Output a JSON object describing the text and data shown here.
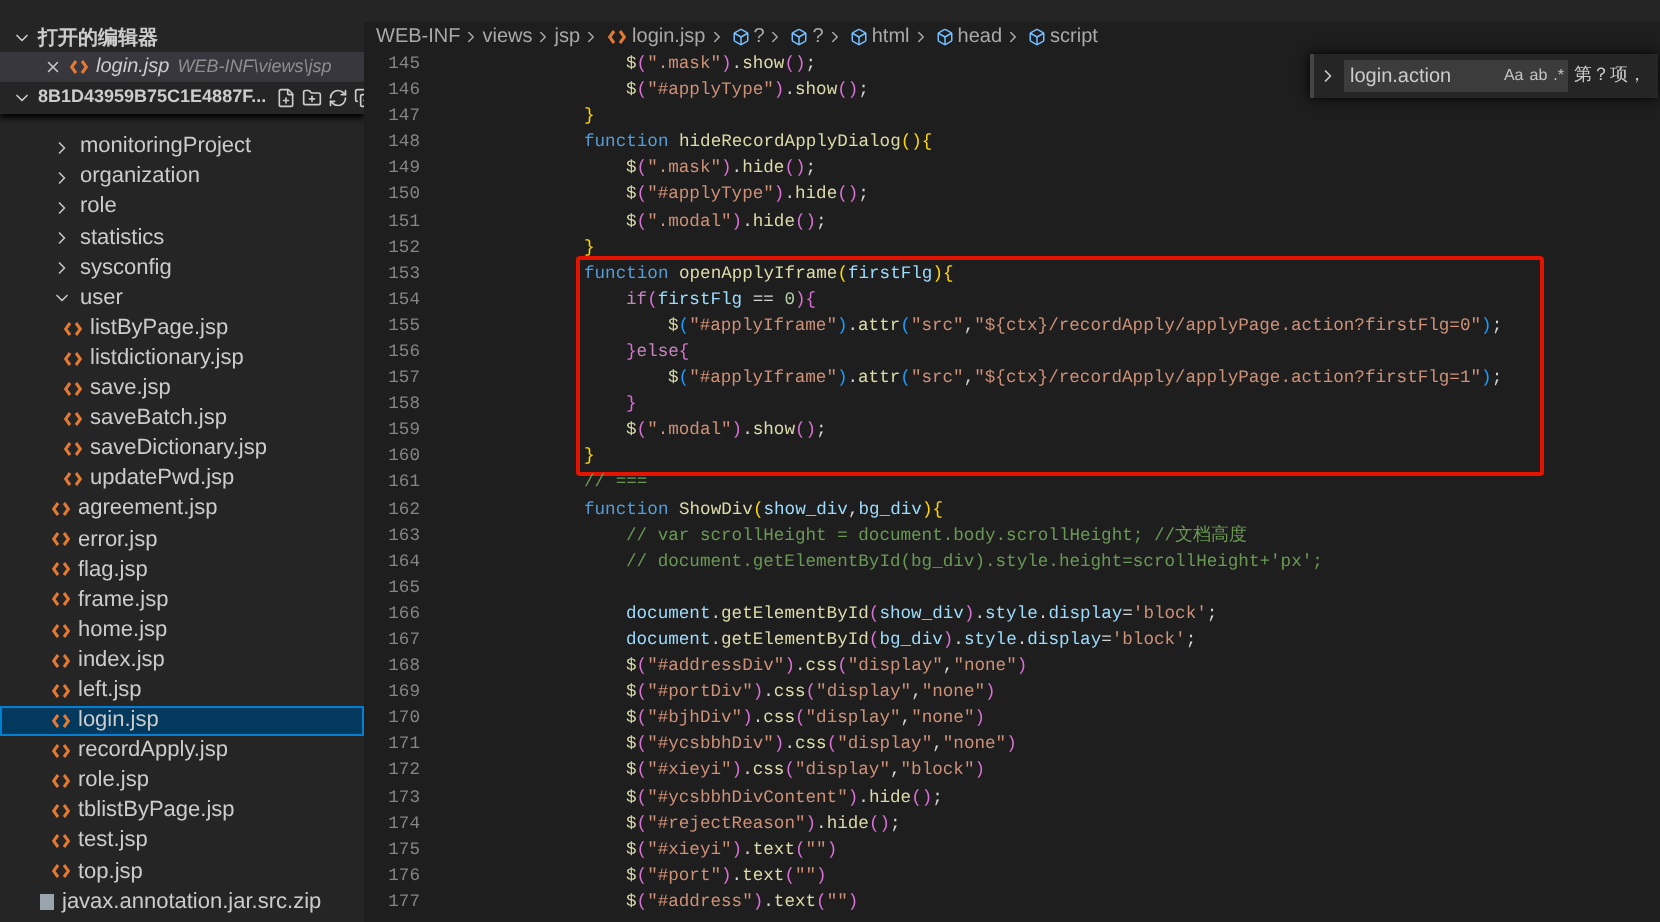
{
  "sidebar": {
    "section_title": "打开的编辑器",
    "section_expanded": true,
    "open_editors": [
      {
        "name": "login.jsp",
        "path": "WEB-INF\\views\\jsp"
      }
    ],
    "folder": {
      "name": "8B1D43959B75C1E4887F...",
      "expanded": true
    },
    "tree": [
      {
        "name": "monitoringProject",
        "kind": "folder",
        "expanded": false,
        "selected": false
      },
      {
        "name": "organization",
        "kind": "folder",
        "expanded": false,
        "selected": false
      },
      {
        "name": "role",
        "kind": "folder",
        "expanded": false,
        "selected": false
      },
      {
        "name": "statistics",
        "kind": "folder",
        "expanded": false,
        "selected": false
      },
      {
        "name": "sysconfig",
        "kind": "folder",
        "expanded": false,
        "selected": false
      },
      {
        "name": "user",
        "kind": "folder",
        "expanded": true,
        "selected": false,
        "children": [
          {
            "name": "listByPage.jsp",
            "kind": "file",
            "selected": false
          },
          {
            "name": "listdictionary.jsp",
            "kind": "file",
            "selected": false
          },
          {
            "name": "save.jsp",
            "kind": "file",
            "selected": false
          },
          {
            "name": "saveBatch.jsp",
            "kind": "file",
            "selected": false
          },
          {
            "name": "saveDictionary.jsp",
            "kind": "file",
            "selected": false
          },
          {
            "name": "updatePwd.jsp",
            "kind": "file",
            "selected": false
          }
        ]
      },
      {
        "name": "agreement.jsp",
        "kind": "file",
        "selected": false
      },
      {
        "name": "error.jsp",
        "kind": "file",
        "selected": false
      },
      {
        "name": "flag.jsp",
        "kind": "file",
        "selected": false
      },
      {
        "name": "frame.jsp",
        "kind": "file",
        "selected": false
      },
      {
        "name": "home.jsp",
        "kind": "file",
        "selected": false
      },
      {
        "name": "index.jsp",
        "kind": "file",
        "selected": false
      },
      {
        "name": "left.jsp",
        "kind": "file",
        "selected": false
      },
      {
        "name": "login.jsp",
        "kind": "file",
        "selected": true
      },
      {
        "name": "recordApply.jsp",
        "kind": "file",
        "selected": false
      },
      {
        "name": "role.jsp",
        "kind": "file",
        "selected": false
      },
      {
        "name": "tblistByPage.jsp",
        "kind": "file",
        "selected": false
      },
      {
        "name": "test.jsp",
        "kind": "file",
        "selected": false
      },
      {
        "name": "top.jsp",
        "kind": "file",
        "selected": false
      },
      {
        "name": "javax.annotation.jar.src.zip",
        "kind": "archive",
        "selected": false
      }
    ]
  },
  "breadcrumbs": [
    {
      "label": "WEB-INF",
      "kind": "folder"
    },
    {
      "label": "views",
      "kind": "folder"
    },
    {
      "label": "jsp",
      "kind": "folder"
    },
    {
      "label": "login.jsp",
      "kind": "file"
    },
    {
      "label": "?",
      "kind": "symbol"
    },
    {
      "label": "?",
      "kind": "symbol"
    },
    {
      "label": "html",
      "kind": "symbol"
    },
    {
      "label": "head",
      "kind": "symbol"
    },
    {
      "label": "script",
      "kind": "symbol"
    }
  ],
  "find_widget": {
    "expanded": false,
    "value": "login.action",
    "options": [
      "Aa",
      "ab",
      ".*"
    ],
    "result": "第？项，"
  },
  "code_blocks": [
    {
      "lines": [
        {
          "number": "145",
          "kind": "level3",
          "tokens": [
            {
              "kind": "fn",
              "text": "$"
            },
            {
              "kind": "b2",
              "text": "("
            },
            {
              "kind": "str",
              "text": "\".mask\""
            },
            {
              "kind": "b2",
              "text": ")"
            },
            {
              "kind": "p",
              "text": "."
            },
            {
              "kind": "fn",
              "text": "show"
            },
            {
              "kind": "b2",
              "text": "()"
            },
            {
              "kind": "p",
              "text": ";"
            }
          ]
        },
        {
          "number": "146",
          "kind": "level3",
          "tokens": [
            {
              "kind": "fn",
              "text": "$"
            },
            {
              "kind": "b2",
              "text": "("
            },
            {
              "kind": "str",
              "text": "\"#applyType\""
            },
            {
              "kind": "b2",
              "text": ")"
            },
            {
              "kind": "p",
              "text": "."
            },
            {
              "kind": "fn",
              "text": "show"
            },
            {
              "kind": "b2",
              "text": "()"
            },
            {
              "kind": "p",
              "text": ";"
            }
          ]
        },
        {
          "number": "147",
          "kind": "level2",
          "tokens": [
            {
              "kind": "b1",
              "text": "}"
            }
          ]
        },
        {
          "number": "148",
          "kind": "level2",
          "tokens": [
            {
              "kind": "kw",
              "text": "function"
            },
            {
              "kind": "fn",
              "text": "hideRecordApplyDialog"
            },
            {
              "kind": "b1",
              "text": "(){"
            }
          ]
        },
        {
          "number": "149",
          "kind": "level3",
          "tokens": [
            {
              "kind": "fn",
              "text": "$"
            },
            {
              "kind": "b2",
              "text": "("
            },
            {
              "kind": "str",
              "text": "\".mask\""
            },
            {
              "kind": "b2",
              "text": ")"
            },
            {
              "kind": "p",
              "text": "."
            },
            {
              "kind": "fn",
              "text": "hide"
            },
            {
              "kind": "b2",
              "text": "()"
            },
            {
              "kind": "p",
              "text": ";"
            }
          ]
        },
        {
          "number": "150",
          "kind": "level3",
          "tokens": [
            {
              "kind": "fn",
              "text": "$"
            },
            {
              "kind": "b2",
              "text": "("
            },
            {
              "kind": "str",
              "text": "\"#applyType\""
            },
            {
              "kind": "b2",
              "text": ")"
            },
            {
              "kind": "p",
              "text": "."
            },
            {
              "kind": "fn",
              "text": "hide"
            },
            {
              "kind": "b2",
              "text": "()"
            },
            {
              "kind": "p",
              "text": ";"
            }
          ]
        },
        {
          "number": "151",
          "kind": "level3",
          "tokens": [
            {
              "kind": "fn",
              "text": "$"
            },
            {
              "kind": "b2",
              "text": "("
            },
            {
              "kind": "str",
              "text": "\".modal\""
            },
            {
              "kind": "b2",
              "text": ")"
            },
            {
              "kind": "p",
              "text": "."
            },
            {
              "kind": "fn",
              "text": "hide"
            },
            {
              "kind": "b2",
              "text": "()"
            },
            {
              "kind": "p",
              "text": ";"
            }
          ]
        },
        {
          "number": "152",
          "kind": "level2",
          "tokens": [
            {
              "kind": "b1",
              "text": "}"
            }
          ]
        }
      ]
    },
    {
      "boxed": true,
      "lines": [
        {
          "number": "153",
          "kind": "level2",
          "tokens": [
            {
              "kind": "kw",
              "text": "function"
            },
            {
              "kind": "fn",
              "text": "openApplyIframe"
            },
            {
              "kind": "b1",
              "text": "("
            },
            {
              "kind": "var",
              "text": "firstFlg"
            },
            {
              "kind": "b1",
              "text": "){"
            }
          ]
        },
        {
          "number": "154",
          "kind": "level3",
          "tokens": [
            {
              "kind": "ctl",
              "text": "if"
            },
            {
              "kind": "b2",
              "text": "("
            },
            {
              "kind": "var",
              "text": "firstFlg"
            },
            {
              "kind": "p",
              "text": " == "
            },
            {
              "kind": "num",
              "text": "0"
            },
            {
              "kind": "b2",
              "text": "){"
            }
          ]
        },
        {
          "number": "155",
          "kind": "level4",
          "tokens": [
            {
              "kind": "fn",
              "text": "$"
            },
            {
              "kind": "b3",
              "text": "("
            },
            {
              "kind": "str",
              "text": "\"#applyIframe\""
            },
            {
              "kind": "b3",
              "text": ")"
            },
            {
              "kind": "p",
              "text": "."
            },
            {
              "kind": "fn",
              "text": "attr"
            },
            {
              "kind": "b3",
              "text": "("
            },
            {
              "kind": "str",
              "text": "\"src\""
            },
            {
              "kind": "p",
              "text": ","
            },
            {
              "kind": "str",
              "text": "\"${ctx}/recordApply/applyPage.action?firstFlg=0\""
            },
            {
              "kind": "b3",
              "text": ")"
            },
            {
              "kind": "p",
              "text": ";"
            }
          ]
        },
        {
          "number": "156",
          "kind": "level3",
          "tokens": [
            {
              "kind": "b2",
              "text": "}"
            },
            {
              "kind": "ctl",
              "text": "else"
            },
            {
              "kind": "b2",
              "text": "{"
            }
          ]
        },
        {
          "number": "157",
          "kind": "level4",
          "tokens": [
            {
              "kind": "fn",
              "text": "$"
            },
            {
              "kind": "b3",
              "text": "("
            },
            {
              "kind": "str",
              "text": "\"#applyIframe\""
            },
            {
              "kind": "b3",
              "text": ")"
            },
            {
              "kind": "p",
              "text": "."
            },
            {
              "kind": "fn",
              "text": "attr"
            },
            {
              "kind": "b3",
              "text": "("
            },
            {
              "kind": "str",
              "text": "\"src\""
            },
            {
              "kind": "p",
              "text": ","
            },
            {
              "kind": "str",
              "text": "\"${ctx}/recordApply/applyPage.action?firstFlg=1\""
            },
            {
              "kind": "b3",
              "text": ")"
            },
            {
              "kind": "p",
              "text": ";"
            }
          ]
        },
        {
          "number": "158",
          "kind": "level3",
          "tokens": [
            {
              "kind": "b2",
              "text": "}"
            }
          ]
        },
        {
          "number": "159",
          "kind": "level3",
          "tokens": [
            {
              "kind": "fn",
              "text": "$"
            },
            {
              "kind": "b2",
              "text": "("
            },
            {
              "kind": "str",
              "text": "\".modal\""
            },
            {
              "kind": "b2",
              "text": ")"
            },
            {
              "kind": "p",
              "text": "."
            },
            {
              "kind": "fn",
              "text": "show"
            },
            {
              "kind": "b2",
              "text": "()"
            },
            {
              "kind": "p",
              "text": ";"
            }
          ]
        },
        {
          "number": "160",
          "kind": "level2",
          "tokens": [
            {
              "kind": "b1",
              "text": "}"
            }
          ]
        }
      ]
    },
    {
      "lines": [
        {
          "number": "161",
          "kind": "level2",
          "tokens": [
            {
              "kind": "cmt",
              "text": "// ==="
            }
          ]
        },
        {
          "number": "162",
          "kind": "level2",
          "tokens": [
            {
              "kind": "kw",
              "text": "function"
            },
            {
              "kind": "fn",
              "text": "ShowDiv"
            },
            {
              "kind": "b1",
              "text": "("
            },
            {
              "kind": "var",
              "text": "show_div"
            },
            {
              "kind": "p",
              "text": ","
            },
            {
              "kind": "var",
              "text": "bg_div"
            },
            {
              "kind": "b1",
              "text": "){"
            }
          ]
        },
        {
          "number": "163",
          "kind": "level3",
          "tokens": [
            {
              "kind": "cmt",
              "text": "// var scrollHeight = document.body.scrollHeight; //文档高度"
            }
          ]
        },
        {
          "number": "164",
          "kind": "level3",
          "tokens": [
            {
              "kind": "cmt",
              "text": "// document.getElementById(bg_div).style.height=scrollHeight+'px';"
            }
          ]
        },
        {
          "number": "165"
        },
        {
          "number": "166",
          "kind": "level3",
          "tokens": [
            {
              "kind": "var",
              "text": "document"
            },
            {
              "kind": "p",
              "text": "."
            },
            {
              "kind": "fn",
              "text": "getElementById"
            },
            {
              "kind": "b2",
              "text": "("
            },
            {
              "kind": "var",
              "text": "show_div"
            },
            {
              "kind": "b2",
              "text": ")"
            },
            {
              "kind": "p",
              "text": "."
            },
            {
              "kind": "var",
              "text": "style"
            },
            {
              "kind": "p",
              "text": "."
            },
            {
              "kind": "var",
              "text": "display"
            },
            {
              "kind": "p",
              "text": "="
            },
            {
              "kind": "str",
              "text": "'block'"
            },
            {
              "kind": "p",
              "text": ";"
            }
          ]
        },
        {
          "number": "167",
          "kind": "level3",
          "tokens": [
            {
              "kind": "var",
              "text": "document"
            },
            {
              "kind": "p",
              "text": "."
            },
            {
              "kind": "fn",
              "text": "getElementById"
            },
            {
              "kind": "b2",
              "text": "("
            },
            {
              "kind": "var",
              "text": "bg_div"
            },
            {
              "kind": "b2",
              "text": ")"
            },
            {
              "kind": "p",
              "text": "."
            },
            {
              "kind": "var",
              "text": "style"
            },
            {
              "kind": "p",
              "text": "."
            },
            {
              "kind": "var",
              "text": "display"
            },
            {
              "kind": "p",
              "text": "="
            },
            {
              "kind": "str",
              "text": "'block'"
            },
            {
              "kind": "p",
              "text": ";"
            }
          ]
        },
        {
          "number": "168",
          "kind": "level3",
          "tokens": [
            {
              "kind": "fn",
              "text": "$"
            },
            {
              "kind": "b2",
              "text": "("
            },
            {
              "kind": "str",
              "text": "\"#addressDiv\""
            },
            {
              "kind": "b2",
              "text": ")"
            },
            {
              "kind": "p",
              "text": "."
            },
            {
              "kind": "fn",
              "text": "css"
            },
            {
              "kind": "b2",
              "text": "("
            },
            {
              "kind": "str",
              "text": "\"display\""
            },
            {
              "kind": "p",
              "text": ","
            },
            {
              "kind": "str",
              "text": "\"none\""
            },
            {
              "kind": "b2",
              "text": ")"
            }
          ]
        },
        {
          "number": "169",
          "kind": "level3",
          "tokens": [
            {
              "kind": "fn",
              "text": "$"
            },
            {
              "kind": "b2",
              "text": "("
            },
            {
              "kind": "str",
              "text": "\"#portDiv\""
            },
            {
              "kind": "b2",
              "text": ")"
            },
            {
              "kind": "p",
              "text": "."
            },
            {
              "kind": "fn",
              "text": "css"
            },
            {
              "kind": "b2",
              "text": "("
            },
            {
              "kind": "str",
              "text": "\"display\""
            },
            {
              "kind": "p",
              "text": ","
            },
            {
              "kind": "str",
              "text": "\"none\""
            },
            {
              "kind": "b2",
              "text": ")"
            }
          ]
        },
        {
          "number": "170",
          "kind": "level3",
          "tokens": [
            {
              "kind": "fn",
              "text": "$"
            },
            {
              "kind": "b2",
              "text": "("
            },
            {
              "kind": "str",
              "text": "\"#bjhDiv\""
            },
            {
              "kind": "b2",
              "text": ")"
            },
            {
              "kind": "p",
              "text": "."
            },
            {
              "kind": "fn",
              "text": "css"
            },
            {
              "kind": "b2",
              "text": "("
            },
            {
              "kind": "str",
              "text": "\"display\""
            },
            {
              "kind": "p",
              "text": ","
            },
            {
              "kind": "str",
              "text": "\"none\""
            },
            {
              "kind": "b2",
              "text": ")"
            }
          ]
        },
        {
          "number": "171",
          "kind": "level3",
          "tokens": [
            {
              "kind": "fn",
              "text": "$"
            },
            {
              "kind": "b2",
              "text": "("
            },
            {
              "kind": "str",
              "text": "\"#ycsbbhDiv\""
            },
            {
              "kind": "b2",
              "text": ")"
            },
            {
              "kind": "p",
              "text": "."
            },
            {
              "kind": "fn",
              "text": "css"
            },
            {
              "kind": "b2",
              "text": "("
            },
            {
              "kind": "str",
              "text": "\"display\""
            },
            {
              "kind": "p",
              "text": ","
            },
            {
              "kind": "str",
              "text": "\"none\""
            },
            {
              "kind": "b2",
              "text": ")"
            }
          ]
        },
        {
          "number": "172",
          "kind": "level3",
          "tokens": [
            {
              "kind": "fn",
              "text": "$"
            },
            {
              "kind": "b2",
              "text": "("
            },
            {
              "kind": "str",
              "text": "\"#xieyi\""
            },
            {
              "kind": "b2",
              "text": ")"
            },
            {
              "kind": "p",
              "text": "."
            },
            {
              "kind": "fn",
              "text": "css"
            },
            {
              "kind": "b2",
              "text": "("
            },
            {
              "kind": "str",
              "text": "\"display\""
            },
            {
              "kind": "p",
              "text": ","
            },
            {
              "kind": "str",
              "text": "\"block\""
            },
            {
              "kind": "b2",
              "text": ")"
            }
          ]
        },
        {
          "number": "173",
          "kind": "level3",
          "tokens": [
            {
              "kind": "fn",
              "text": "$"
            },
            {
              "kind": "b2",
              "text": "("
            },
            {
              "kind": "str",
              "text": "\"#ycsbbhDivContent\""
            },
            {
              "kind": "b2",
              "text": ")"
            },
            {
              "kind": "p",
              "text": "."
            },
            {
              "kind": "fn",
              "text": "hide"
            },
            {
              "kind": "b2",
              "text": "()"
            },
            {
              "kind": "p",
              "text": ";"
            }
          ]
        },
        {
          "number": "174",
          "kind": "level3",
          "tokens": [
            {
              "kind": "fn",
              "text": "$"
            },
            {
              "kind": "b2",
              "text": "("
            },
            {
              "kind": "str",
              "text": "\"#rejectReason\""
            },
            {
              "kind": "b2",
              "text": ")"
            },
            {
              "kind": "p",
              "text": "."
            },
            {
              "kind": "fn",
              "text": "hide"
            },
            {
              "kind": "b2",
              "text": "()"
            },
            {
              "kind": "p",
              "text": ";"
            }
          ]
        },
        {
          "number": "175",
          "kind": "level3",
          "tokens": [
            {
              "kind": "fn",
              "text": "$"
            },
            {
              "kind": "b2",
              "text": "("
            },
            {
              "kind": "str",
              "text": "\"#xieyi\""
            },
            {
              "kind": "b2",
              "text": ")"
            },
            {
              "kind": "p",
              "text": "."
            },
            {
              "kind": "fn",
              "text": "text"
            },
            {
              "kind": "b2",
              "text": "("
            },
            {
              "kind": "str",
              "text": "\"\""
            },
            {
              "kind": "b2",
              "text": ")"
            }
          ]
        },
        {
          "number": "176",
          "kind": "level3",
          "tokens": [
            {
              "kind": "fn",
              "text": "$"
            },
            {
              "kind": "b2",
              "text": "("
            },
            {
              "kind": "str",
              "text": "\"#port\""
            },
            {
              "kind": "b2",
              "text": ")"
            },
            {
              "kind": "p",
              "text": "."
            },
            {
              "kind": "fn",
              "text": "text"
            },
            {
              "kind": "b2",
              "text": "("
            },
            {
              "kind": "str",
              "text": "\"\""
            },
            {
              "kind": "b2",
              "text": ")"
            }
          ]
        },
        {
          "number": "177",
          "kind": "level3",
          "tokens": [
            {
              "kind": "fn",
              "text": "$"
            },
            {
              "kind": "b2",
              "text": "("
            },
            {
              "kind": "str",
              "text": "\"#address\""
            },
            {
              "kind": "b2",
              "text": ")"
            },
            {
              "kind": "p",
              "text": "."
            },
            {
              "kind": "fn",
              "text": "text"
            },
            {
              "kind": "b2",
              "text": "("
            },
            {
              "kind": "str",
              "text": "\"\""
            },
            {
              "kind": "b2",
              "text": ")"
            }
          ]
        }
      ]
    }
  ]
}
